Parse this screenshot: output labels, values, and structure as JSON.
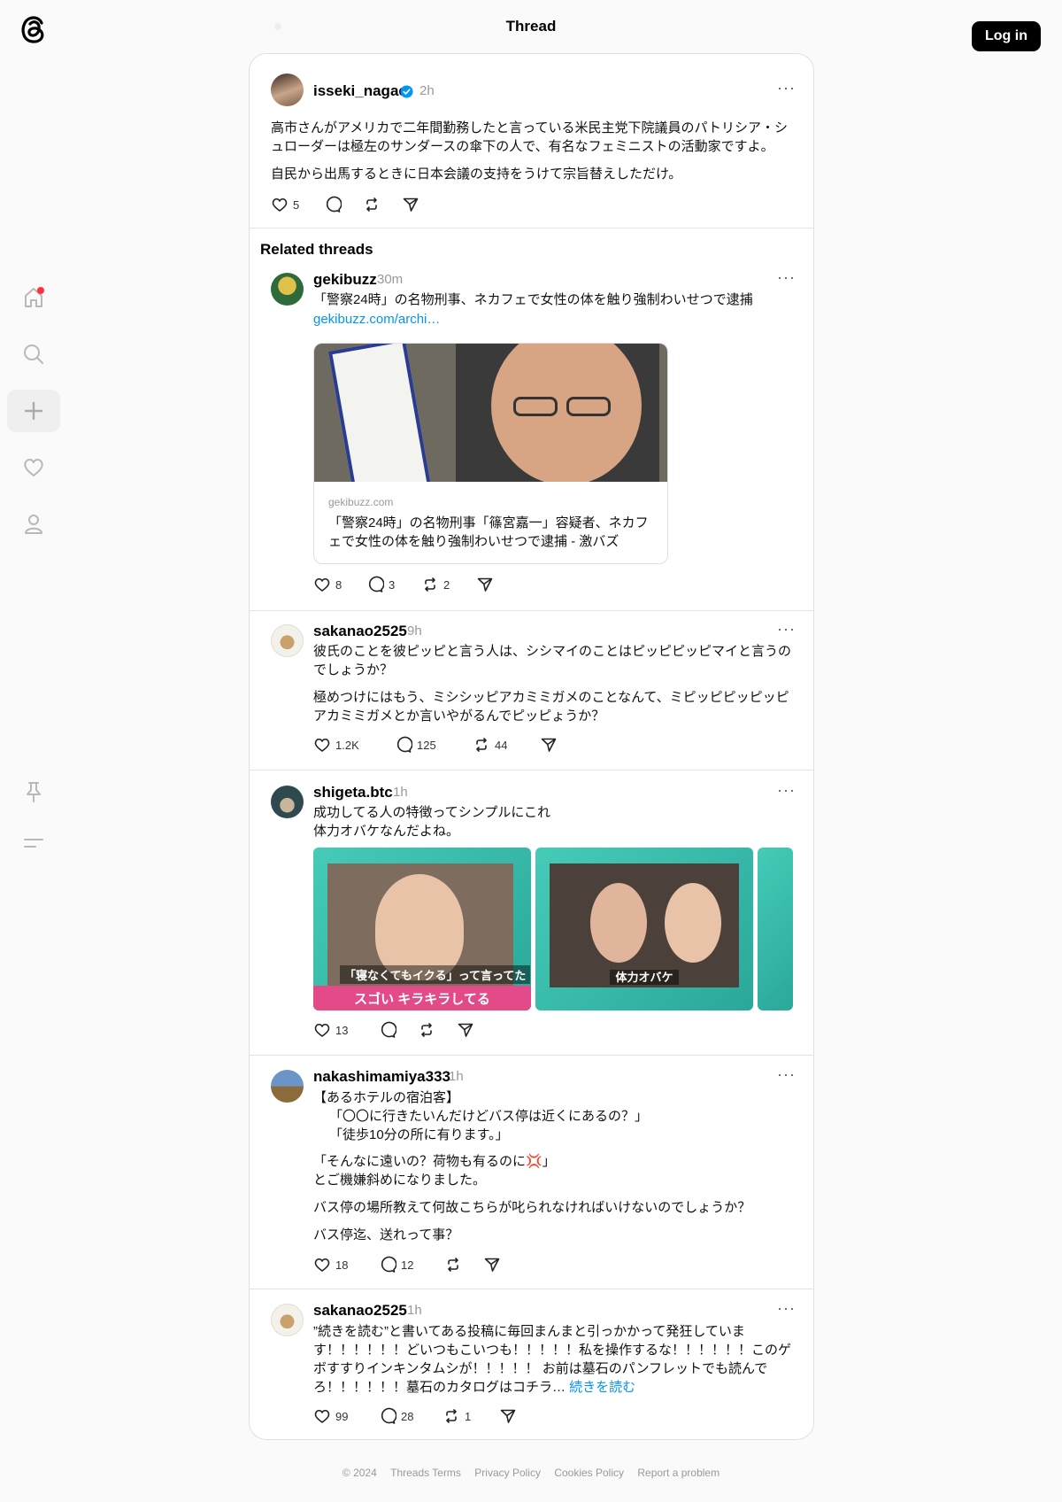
{
  "header": {
    "title": "Thread",
    "login_label": "Log in"
  },
  "nav": [
    "home-icon",
    "search-icon",
    "create-icon",
    "activity-heart-icon",
    "profile-icon",
    "pin-icon",
    "menu-icon"
  ],
  "main_post": {
    "username": "isseki_nagae",
    "time": "2h",
    "para1": "高市さんがアメリカで二年間勤務したと言っている米民主党下院議員のパトリシア・シュローダーは極左のサンダースの傘下の人で、有名なフェミニストの活動家ですよ。",
    "para2": "自民から出馬するときに日本会議の支持をうけて宗旨替えしただけ。",
    "likes": "5"
  },
  "related_title": "Related threads",
  "posts": [
    {
      "username": "gekibuzz",
      "time": "30m",
      "text": "「警察24時」の名物刑事、ネカフェで女性の体を触り強制わいせつで逮捕",
      "link": "gekibuzz.com/archi…",
      "card_domain": "gekibuzz.com",
      "card_title": "「警察24時」の名物刑事「篠宮嘉一」容疑者、ネカフェで女性の体を触り強制わいせつで逮捕 - 激バズ",
      "likes": "8",
      "replies": "3",
      "reposts": "2"
    },
    {
      "username": "sakanao2525",
      "time": "9h",
      "para1": "彼氏のことを彼ピッピと言う人は、シシマイのことはピッピピッピマイと言うのでしょうか？",
      "para2": "極めつけにはもう、ミシシッピアカミミガメのことなんて、ミピッピピッピッピアカミミガメとか言いやがるんでピッピょうか？",
      "likes": "1.2K",
      "replies": "125",
      "reposts": "44"
    },
    {
      "username": "shigeta.btc",
      "time": "1h",
      "line1": "成功してる人の特徴ってシンプルにこれ",
      "line2": "体力オバケなんだよね。",
      "media_captions": [
        "「寝なくてもイクる」って言ってた",
        "スゴい キラキラしてる",
        "体力オバケ"
      ],
      "likes": "13"
    },
    {
      "username": "nakashimamiya333",
      "time": "1h",
      "l1": "【あるホテルの宿泊客】",
      "l2": "「〇〇に行きたいんだけどバス停は近くにあるの？」",
      "l3": "「徒歩10分の所に有ります。」",
      "l4": "「そんなに遠いの？荷物も有るのに💢」",
      "l5": "とご機嫌斜めになりました。",
      "l6": "バス停の場所教えて何故こちらが叱られなければいけないのでしょうか？",
      "l7": "バス停迄、送れって事？",
      "likes": "18",
      "replies": "12"
    },
    {
      "username": "sakanao2525",
      "time": "1h",
      "text": "”続きを読む”と書いてある投稿に毎回まんまと引っかかって発狂しています！！！！！！どいつもこいつも！！！！！私を操作するな！！！！！！このゲボすすりインキンタムシが！！！！！ お前は墓石のパンフレットでも読んでろ！！！！！！墓石のカタログはコチラ… ",
      "read_more": "続きを読む",
      "likes": "99",
      "replies": "28",
      "reposts": "1"
    }
  ],
  "footer": [
    "© 2024",
    "Threads Terms",
    "Privacy Policy",
    "Cookies Policy",
    "Report a problem"
  ]
}
